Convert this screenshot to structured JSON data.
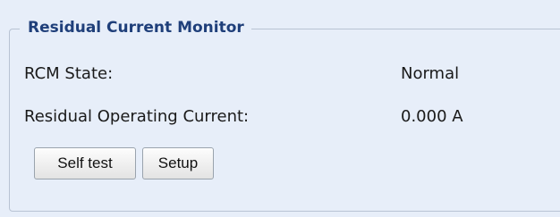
{
  "panel": {
    "title": "Residual Current Monitor",
    "rows": [
      {
        "label": "RCM State:",
        "value": "Normal"
      },
      {
        "label": "Residual Operating Current:",
        "value": "0.000 A"
      }
    ],
    "buttons": {
      "self_test_label": "Self test",
      "setup_label": "Setup"
    }
  },
  "colors": {
    "panel_background": "#e7eef9",
    "legend_text": "#1f3f7a",
    "fieldset_border": "#b8c3d3"
  }
}
